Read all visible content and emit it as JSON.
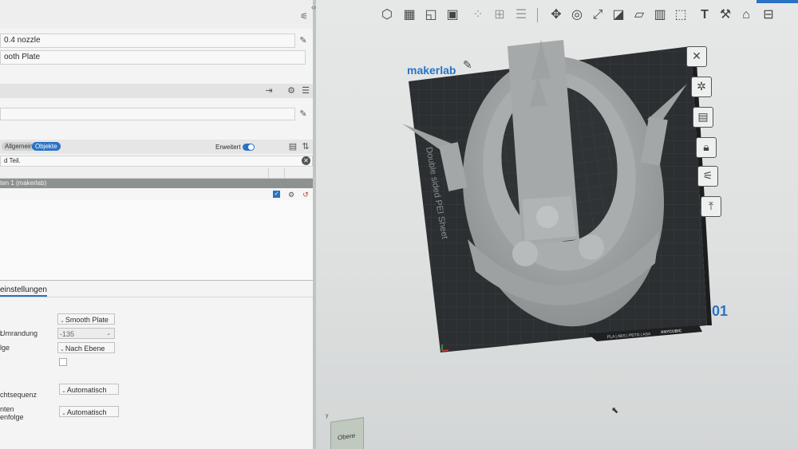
{
  "left": {
    "printer_value": "0.4 nozzle",
    "plate_value": "ooth Plate",
    "tabs": [
      "Allgemein",
      "Objekte"
    ],
    "advanced_label": "Erweitert",
    "search_text": "d Teil.",
    "object_row": "ten 1 (makerlab)",
    "section_title": "einstellungen",
    "settings": [
      {
        "label": "",
        "value": "Smooth Plate"
      },
      {
        "label": "Umrandung",
        "value": "-135"
      },
      {
        "label": "lge",
        "value": "Nach Ebene"
      },
      {
        "label": "chtsequenz",
        "value": "Automatisch"
      },
      {
        "label": "nten\nenfolge",
        "value": "Automatisch"
      }
    ]
  },
  "viewport": {
    "plate_brand": "makerlab",
    "plate_number": "01",
    "sheet_text": "Double sided PEI Sheet",
    "plate_material_text": "PLA | ABS | PETG | ASA",
    "plate_maker_text": "ANYCUBIC",
    "cube_label": "Obere",
    "axis_y_label": "y"
  },
  "colors": {
    "accent": "#2a73c4",
    "plate": "#2c2f31",
    "model": "#9c9f9f"
  },
  "icons": {
    "toolbar": [
      "add-cube-icon",
      "grid-icon",
      "orient-icon",
      "arrange-icon",
      "split-icon",
      "split-parts-icon",
      "layers-icon",
      "move-icon",
      "rotate-icon",
      "scale-icon",
      "cut-icon",
      "support-paint-icon",
      "seam-icon",
      "text-icon",
      "measure-icon",
      "assembly-icon"
    ],
    "side": [
      "close-icon",
      "orient-plate-icon",
      "arrange-plate-icon",
      "lock-icon",
      "plate-settings-icon",
      "upload-icon"
    ]
  }
}
